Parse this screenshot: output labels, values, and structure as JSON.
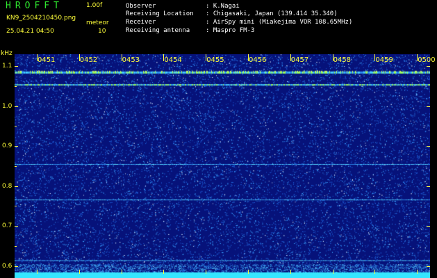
{
  "header": {
    "app_title": "HROFFT",
    "version": "1.00f",
    "filename": "KN9_2504210450.png",
    "mode": "meteor",
    "datetime": "25.04.21 04:50",
    "level": "10"
  },
  "info": {
    "observer_label": "Observer",
    "observer_value": ": K.Nagai",
    "location_label": "Receiving Location",
    "location_value": ": Chigasaki, Japan (139.414 35.340)",
    "receiver_label": "Receiver",
    "receiver_value": ": AirSpy mini (Miakejima VOR 108.65MHz)",
    "antenna_label": "Receiving antenna",
    "antenna_value": ": Maspro FM-3"
  },
  "axes": {
    "y_unit": "kHz",
    "x_ticks": [
      "0451",
      "0452",
      "0453",
      "0454",
      "0455",
      "0456",
      "0457",
      "0458",
      "0459",
      "0500"
    ],
    "y_ticks": [
      "1.1",
      "1.0",
      "0.9",
      "0.8",
      "0.7",
      "0.6"
    ]
  },
  "chart_data": {
    "type": "heatmap",
    "ylabel": "kHz",
    "x_ticks": [
      "0451",
      "0452",
      "0453",
      "0454",
      "0455",
      "0456",
      "0457",
      "0458",
      "0459",
      "0500"
    ],
    "y_ticks": [
      1.1,
      1.0,
      0.9,
      0.8,
      0.7,
      0.6
    ],
    "ylim": [
      0.58,
      1.13
    ],
    "horizontal_bands_khz": [
      1.085,
      1.055,
      0.766,
      0.855,
      0.614
    ],
    "colors": {
      "background": "#06127a",
      "noise": "#3aa0ff",
      "band": "#9fff5a",
      "text": "#ffff3a",
      "title": "#2ee62e"
    }
  }
}
